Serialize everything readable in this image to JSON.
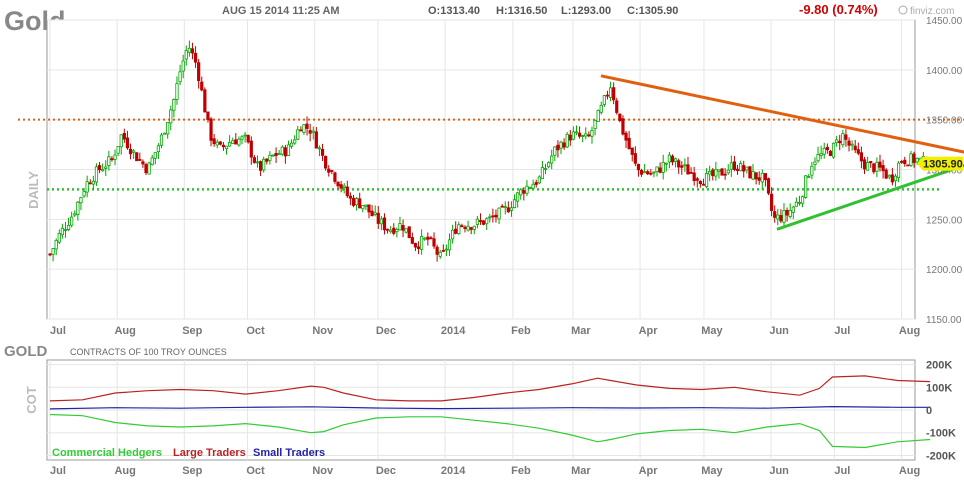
{
  "header": {
    "symbol": "Gold",
    "datetime": "AUG 15 2014 11:25 AM",
    "open": "O:1313.40",
    "high": "H:1316.50",
    "low": "L:1293.00",
    "close": "C:1305.90",
    "change": "-9.80 (0.74%)",
    "watermark": "finviz.com"
  },
  "colors": {
    "up": "#00a800",
    "down": "#c00000",
    "resistance": "#e06010",
    "support": "#30c030",
    "cot_commercial": "#33cc33",
    "cot_large": "#bb2222",
    "cot_small": "#2222aa",
    "price_badge": "#f0f000",
    "grid": "#e6e6e6"
  },
  "chart_data": [
    {
      "type": "candlestick",
      "name": "price-chart",
      "side_label": "DAILY",
      "xlabel": "",
      "ylabel": "",
      "ylim": [
        1150,
        1450
      ],
      "y_ticks": [
        "1150.00",
        "1200.00",
        "1250.00",
        "1300.00",
        "1350.00",
        "1400.00",
        "1450.00"
      ],
      "x_ticks": [
        "Jul",
        "Aug",
        "Sep",
        "Oct",
        "Nov",
        "Dec",
        "2014",
        "Feb",
        "Mar",
        "Apr",
        "May",
        "Jun",
        "Jul",
        "Aug"
      ],
      "x_tick_index": [
        0,
        1.03,
        2.06,
        3.03,
        4.06,
        5.03,
        6.06,
        7.1,
        8.02,
        9.05,
        10.03,
        11.06,
        12.03,
        13.06
      ],
      "last_price_label": "1305.90",
      "close_path": [
        [
          0,
          1215
        ],
        [
          0.15,
          1235
        ],
        [
          0.35,
          1255
        ],
        [
          0.55,
          1285
        ],
        [
          0.75,
          1300
        ],
        [
          0.95,
          1310
        ],
        [
          1.1,
          1335
        ],
        [
          1.3,
          1315
        ],
        [
          1.5,
          1300
        ],
        [
          1.7,
          1330
        ],
        [
          1.9,
          1370
        ],
        [
          2.0,
          1400
        ],
        [
          2.12,
          1425
        ],
        [
          2.25,
          1405
        ],
        [
          2.45,
          1335
        ],
        [
          2.6,
          1320
        ],
        [
          2.8,
          1330
        ],
        [
          3.0,
          1330
        ],
        [
          3.2,
          1300
        ],
        [
          3.45,
          1315
        ],
        [
          3.65,
          1320
        ],
        [
          3.85,
          1345
        ],
        [
          4.0,
          1340
        ],
        [
          4.2,
          1310
        ],
        [
          4.4,
          1290
        ],
        [
          4.6,
          1270
        ],
        [
          4.8,
          1265
        ],
        [
          5.0,
          1250
        ],
        [
          5.2,
          1240
        ],
        [
          5.4,
          1245
        ],
        [
          5.6,
          1225
        ],
        [
          5.8,
          1230
        ],
        [
          6.0,
          1210
        ],
        [
          6.1,
          1225
        ],
        [
          6.25,
          1245
        ],
        [
          6.5,
          1245
        ],
        [
          6.75,
          1250
        ],
        [
          7.0,
          1260
        ],
        [
          7.25,
          1280
        ],
        [
          7.5,
          1290
        ],
        [
          7.75,
          1320
        ],
        [
          8.0,
          1335
        ],
        [
          8.25,
          1330
        ],
        [
          8.45,
          1360
        ],
        [
          8.6,
          1385
        ],
        [
          8.75,
          1345
        ],
        [
          9.0,
          1300
        ],
        [
          9.25,
          1295
        ],
        [
          9.5,
          1310
        ],
        [
          9.75,
          1300
        ],
        [
          10.0,
          1290
        ],
        [
          10.25,
          1295
        ],
        [
          10.5,
          1305
        ],
        [
          10.75,
          1295
        ],
        [
          10.95,
          1290
        ],
        [
          11.1,
          1250
        ],
        [
          11.3,
          1255
        ],
        [
          11.5,
          1270
        ],
        [
          11.7,
          1310
        ],
        [
          12.0,
          1320
        ],
        [
          12.15,
          1335
        ],
        [
          12.3,
          1320
        ],
        [
          12.5,
          1305
        ],
        [
          12.75,
          1300
        ],
        [
          12.9,
          1290
        ],
        [
          13.05,
          1310
        ],
        [
          13.3,
          1310
        ],
        [
          13.45,
          1306
        ]
      ],
      "resistance_horizontal": 1350,
      "support_horizontal": 1280,
      "resistance_trend": [
        [
          8.45,
          1394
        ],
        [
          14.2,
          1315
        ]
      ],
      "support_trend": [
        [
          11.15,
          1240
        ],
        [
          14.2,
          1308
        ]
      ]
    },
    {
      "type": "line",
      "name": "cot-chart",
      "title": "GOLD",
      "subtitle": "CONTRACTS OF 100 TROY OUNCES",
      "side_label": "COT",
      "ylim": [
        -220000,
        220000
      ],
      "y_ticks": [
        "200K",
        "100K",
        "0",
        "-100K",
        "-200K"
      ],
      "x_ticks": [
        "Jul",
        "Aug",
        "Sep",
        "Oct",
        "Nov",
        "Dec",
        "2014",
        "Feb",
        "Mar",
        "Apr",
        "May",
        "Jun",
        "Jul",
        "Aug"
      ],
      "series": [
        {
          "name": "Commercial Hedgers",
          "color": "#33cc33",
          "points": [
            [
              0,
              -20000
            ],
            [
              0.5,
              -25000
            ],
            [
              1,
              -55000
            ],
            [
              1.5,
              -70000
            ],
            [
              2,
              -75000
            ],
            [
              2.5,
              -70000
            ],
            [
              3,
              -60000
            ],
            [
              3.5,
              -75000
            ],
            [
              4,
              -100000
            ],
            [
              4.2,
              -95000
            ],
            [
              4.5,
              -65000
            ],
            [
              5,
              -35000
            ],
            [
              5.5,
              -30000
            ],
            [
              6,
              -30000
            ],
            [
              6.5,
              -45000
            ],
            [
              7,
              -60000
            ],
            [
              7.5,
              -80000
            ],
            [
              8,
              -110000
            ],
            [
              8.4,
              -140000
            ],
            [
              8.6,
              -130000
            ],
            [
              9,
              -105000
            ],
            [
              9.5,
              -90000
            ],
            [
              10,
              -85000
            ],
            [
              10.5,
              -100000
            ],
            [
              11,
              -75000
            ],
            [
              11.5,
              -60000
            ],
            [
              11.8,
              -90000
            ],
            [
              12,
              -160000
            ],
            [
              12.5,
              -165000
            ],
            [
              13,
              -140000
            ],
            [
              13.5,
              -130000
            ]
          ]
        },
        {
          "name": "Large Traders",
          "color": "#bb2222",
          "points": [
            [
              0,
              40000
            ],
            [
              0.5,
              45000
            ],
            [
              1,
              75000
            ],
            [
              1.5,
              85000
            ],
            [
              2,
              90000
            ],
            [
              2.5,
              85000
            ],
            [
              3,
              70000
            ],
            [
              3.5,
              85000
            ],
            [
              4,
              105000
            ],
            [
              4.2,
              100000
            ],
            [
              4.5,
              75000
            ],
            [
              5,
              45000
            ],
            [
              5.5,
              40000
            ],
            [
              6,
              40000
            ],
            [
              6.5,
              55000
            ],
            [
              7,
              75000
            ],
            [
              7.5,
              90000
            ],
            [
              8,
              115000
            ],
            [
              8.4,
              140000
            ],
            [
              8.6,
              130000
            ],
            [
              9,
              110000
            ],
            [
              9.5,
              95000
            ],
            [
              10,
              90000
            ],
            [
              10.5,
              100000
            ],
            [
              11,
              80000
            ],
            [
              11.5,
              65000
            ],
            [
              11.8,
              95000
            ],
            [
              12,
              145000
            ],
            [
              12.5,
              150000
            ],
            [
              13,
              130000
            ],
            [
              13.5,
              125000
            ]
          ]
        },
        {
          "name": "Small Traders",
          "color": "#2222aa",
          "points": [
            [
              0,
              5000
            ],
            [
              1,
              10000
            ],
            [
              2,
              8000
            ],
            [
              3,
              12000
            ],
            [
              4,
              14000
            ],
            [
              5,
              9000
            ],
            [
              6,
              6000
            ],
            [
              7,
              8000
            ],
            [
              8,
              10000
            ],
            [
              9,
              9000
            ],
            [
              10,
              10000
            ],
            [
              11,
              8000
            ],
            [
              12,
              15000
            ],
            [
              13,
              12000
            ],
            [
              13.5,
              12000
            ]
          ]
        }
      ]
    }
  ]
}
